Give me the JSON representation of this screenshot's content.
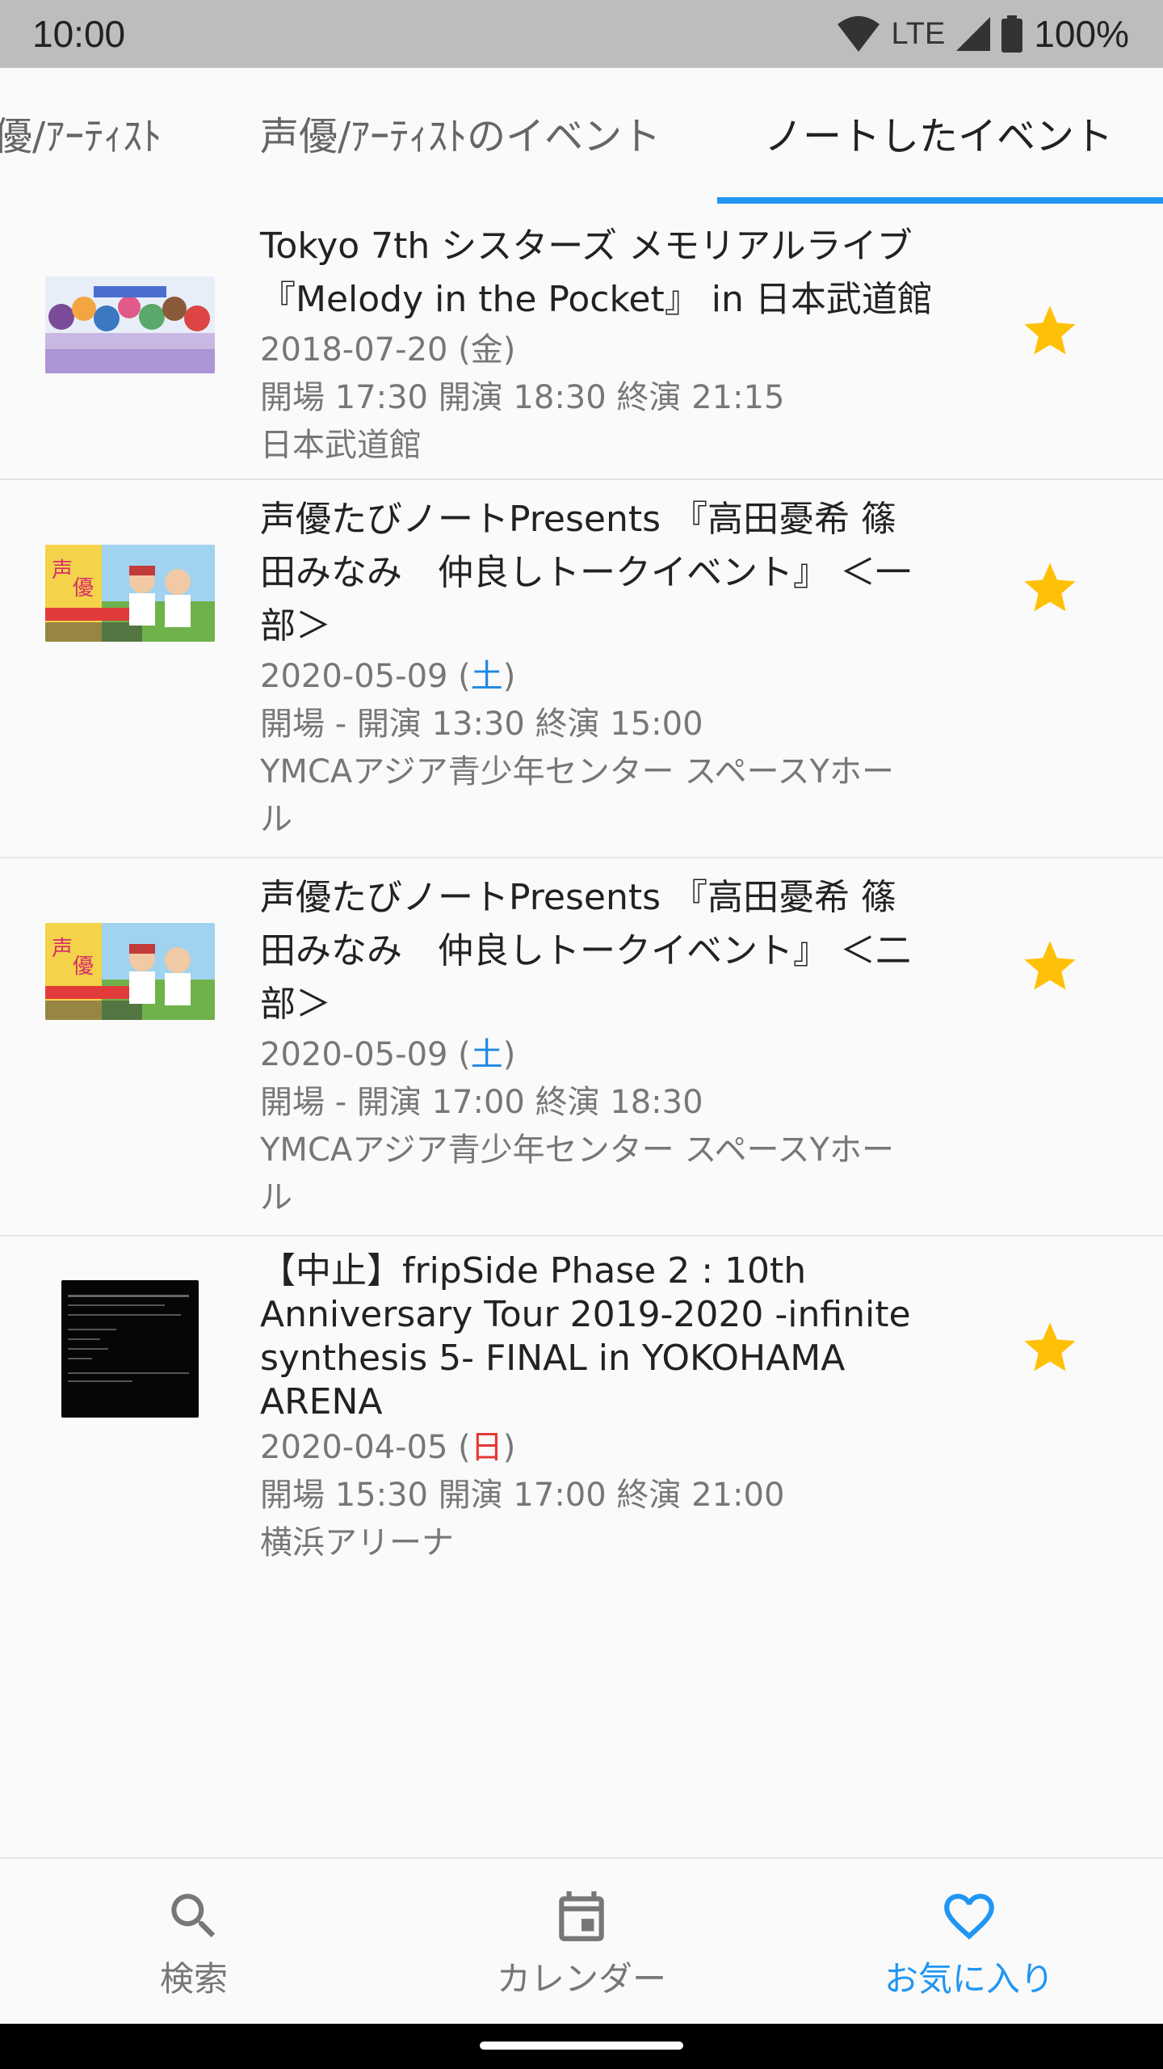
{
  "status_bar": {
    "time": "10:00",
    "network": "LTE",
    "battery": "100%"
  },
  "tabs": [
    {
      "label": "優/ｱｰﾃｨｽﾄ",
      "active": false
    },
    {
      "label": "声優/ｱｰﾃｨｽﾄのイベント",
      "active": false
    },
    {
      "label": "ノートしたイベント",
      "active": true
    }
  ],
  "events": [
    {
      "title_lines": [
        "Tokyo 7th シスターズ メモリアルライブ",
        "『Melody in the Pocket』 in 日本武道館"
      ],
      "date": "2018-07-20",
      "weekday": "金",
      "times": "開場 17:30 開演 18:30 終演 21:15",
      "venue_lines": [
        "日本武道館"
      ],
      "favorited": true,
      "thumb_icon": "anime-cast-thumbnail-icon"
    },
    {
      "title_lines": [
        "声優たびノートPresents 『高田憂希 篠",
        "田みなみ　仲良しトークイベント』 ＜一",
        "部＞"
      ],
      "date": "2020-05-09",
      "weekday": "土",
      "times": "開場 - 開演 13:30 終演 15:00",
      "venue_lines": [
        "YMCAアジア青少年センター スペースYホー",
        "ル"
      ],
      "favorited": true,
      "thumb_icon": "event-flyer-thumbnail-icon"
    },
    {
      "title_lines": [
        "声優たびノートPresents 『高田憂希 篠",
        "田みなみ　仲良しトークイベント』 ＜二",
        "部＞"
      ],
      "date": "2020-05-09",
      "weekday": "土",
      "times": "開場 - 開演 17:00 終演 18:30",
      "venue_lines": [
        "YMCAアジア青少年センター スペースYホー",
        "ル"
      ],
      "favorited": true,
      "thumb_icon": "event-flyer-thumbnail-icon"
    },
    {
      "title_lines": [
        "【中止】fripSide Phase 2 : 10th",
        "Anniversary Tour 2019-2020 -infinite",
        "synthesis 5- FINAL in YOKOHAMA",
        "ARENA"
      ],
      "date": "2020-04-05",
      "weekday": "日",
      "times": "開場 15:30 開演 17:00 終演 21:00",
      "venue_lines": [
        "横浜アリーナ"
      ],
      "favorited": true,
      "thumb_icon": "notice-screen-thumbnail-icon"
    }
  ],
  "bottom_nav": [
    {
      "label": "検索",
      "icon": "search-icon",
      "active": false
    },
    {
      "label": "カレンダー",
      "icon": "calendar-icon",
      "active": false
    },
    {
      "label": "お気に入り",
      "icon": "heart-icon",
      "active": true
    }
  ],
  "colors": {
    "accent": "#2196f3",
    "star": "#ffc107",
    "saturday": "#1e88e5",
    "sunday": "#e53935"
  }
}
